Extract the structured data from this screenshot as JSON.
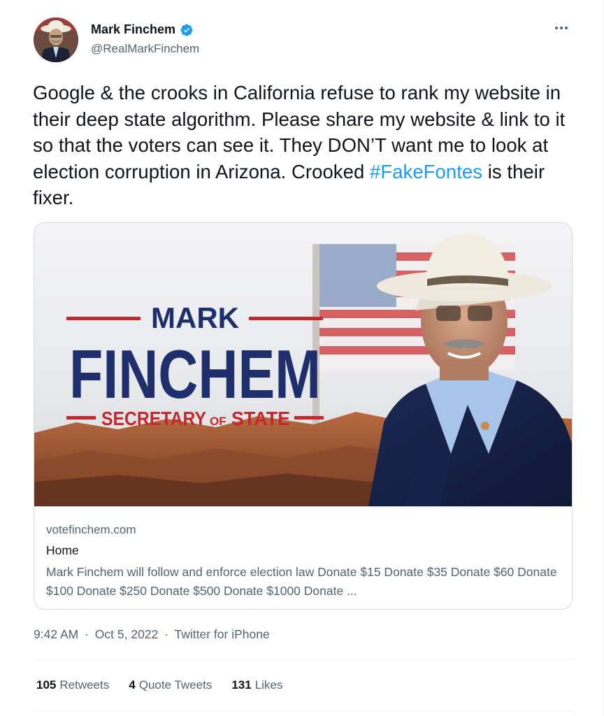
{
  "tweet": {
    "author": {
      "display_name": "Mark Finchem",
      "handle": "@RealMarkFinchem",
      "verified": true
    },
    "text_parts": {
      "before_hashtag": "Google & the crooks in California refuse to rank my website in their deep state algorithm. Please share my website & link to it so that the voters can see it. They DON’T want me to look at election corruption in Arizona. Crooked ",
      "hashtag": "#FakeFontes",
      "after_hashtag": " is their fixer."
    },
    "card": {
      "image_text": {
        "first": "MARK",
        "last": "FINCHEM",
        "office_part1": "SECRETARY",
        "office_part2": "OF",
        "office_part3": "STATE"
      },
      "domain": "votefinchem.com",
      "title": "Home",
      "description": "Mark Finchem will follow and enforce election law Donate $15 Donate $35 Donate $60 Donate $100 Donate $250 Donate $500 Donate $1000 Donate ..."
    },
    "timestamp": {
      "time": "9:42 AM",
      "separator": "·",
      "date": "Oct 5, 2022",
      "source": "Twitter for iPhone"
    },
    "stats": {
      "retweets_count": "105",
      "retweets_label": "Retweets",
      "quotes_count": "4",
      "quotes_label": "Quote Tweets",
      "likes_count": "131",
      "likes_label": "Likes"
    }
  },
  "colors": {
    "link_blue": "#1d9bf0",
    "secondary_text": "#536471",
    "primary_text": "#0f1419",
    "banner_navy": "#1f2f6b",
    "banner_red": "#c5282f"
  }
}
